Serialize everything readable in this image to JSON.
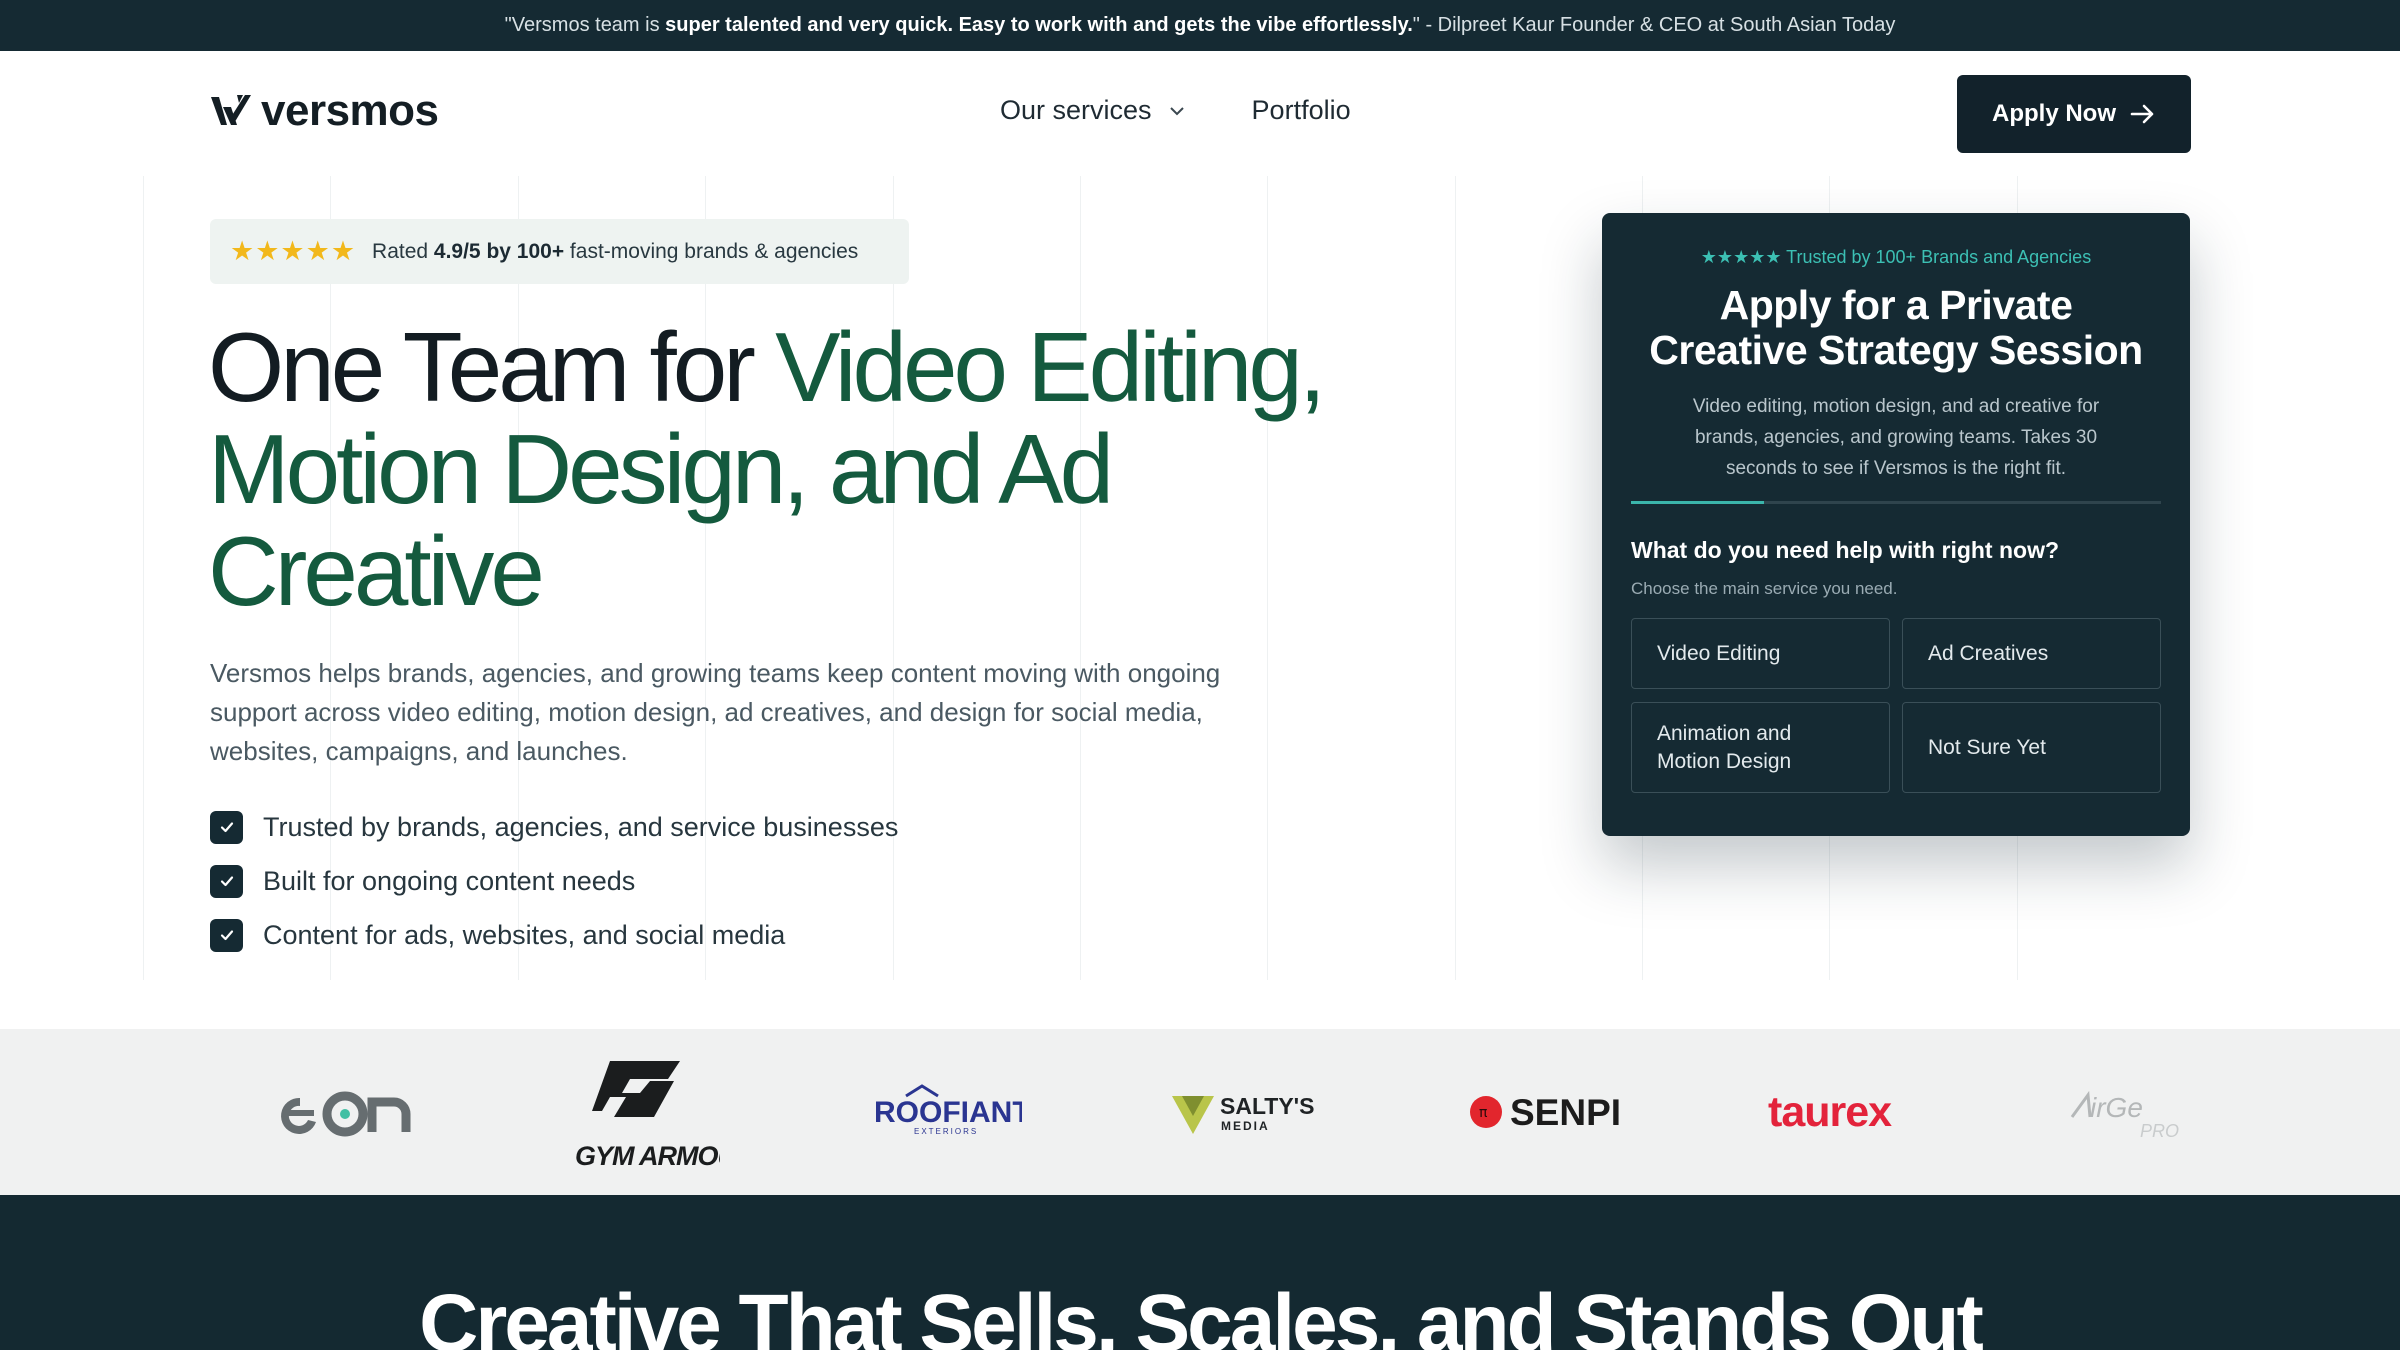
{
  "topbar": {
    "quote_open": "\"Versmos team is ",
    "quote_bold": "super talented and very quick. Easy to work with and gets the vibe effortlessly.",
    "quote_close": "\" - Dilpreet Kaur Founder & CEO at South Asian Today"
  },
  "header": {
    "logo_text": "versmos",
    "nav": [
      {
        "label": "Our services",
        "icon": "chevron-down-icon"
      },
      {
        "label": "Portfolio"
      }
    ],
    "apply_label": "Apply Now",
    "apply_icon": "arrow-right-icon"
  },
  "hero": {
    "rating_prefix": "Rated ",
    "rating_bold": "4.9/5 by 100+",
    "rating_suffix": " fast-moving brands & agencies",
    "rating_stars": "★★★★★",
    "headline_dark": "One Team for ",
    "headline_green": "Video Editing, Motion Design, and Ad Creative",
    "subtext": "Versmos helps brands, agencies, and growing teams keep content moving with ongoing support across video editing, motion design, ad creatives, and design for social media, websites, campaigns, and launches.",
    "checks": [
      "Trusted by brands, agencies, and service businesses",
      "Built for ongoing content needs",
      "Content for ads, websites, and social media"
    ]
  },
  "card": {
    "trust": "★★★★★ Trusted by 100+ Brands and Agencies",
    "title_line1": "Apply for a Private",
    "title_line2": "Creative Strategy Session",
    "desc": "Video editing, motion design, and ad creative for brands, agencies, and growing teams. Takes 30 seconds to see if Versmos is the right fit.",
    "progress": 0.25,
    "question": "What do you need help with right now?",
    "question_sub": "Choose the main service you need.",
    "options": [
      "Video Editing",
      "Ad Creatives",
      "Animation and Motion Design",
      "Not Sure Yet"
    ]
  },
  "logos": [
    {
      "name": "eon"
    },
    {
      "name": "GYM ARMOUR"
    },
    {
      "name": "ROOFIANT",
      "sub": "EXTERIORS"
    },
    {
      "name": "SALTY'S",
      "sub": "MEDIA"
    },
    {
      "name": "SENPI"
    },
    {
      "name": "taurex"
    },
    {
      "name": "AirGe",
      "sub": "PRO"
    }
  ],
  "colors": {
    "dark": "#152a33",
    "green": "#145a3e",
    "teal": "#3bb5ab",
    "star": "#f2b81b"
  },
  "bottom": {
    "title": "Creative That Sells, Scales, and Stands Out"
  }
}
